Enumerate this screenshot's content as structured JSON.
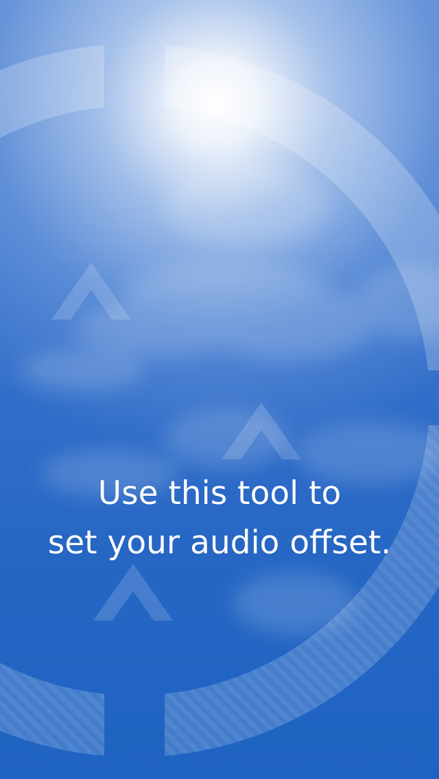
{
  "screen": {
    "name": "audio-offset-tutorial",
    "message_lines": [
      "Use this tool to",
      "set your audio offset."
    ]
  },
  "colors": {
    "background_top": "#4f82d2",
    "background_bottom": "#1f63c2",
    "overlay_shapes": "#ffffff",
    "text": "#ffffff"
  },
  "icons": [
    "up-arrow-icon",
    "up-arrow-icon",
    "up-arrow-icon",
    "ring-arc-graphic"
  ]
}
